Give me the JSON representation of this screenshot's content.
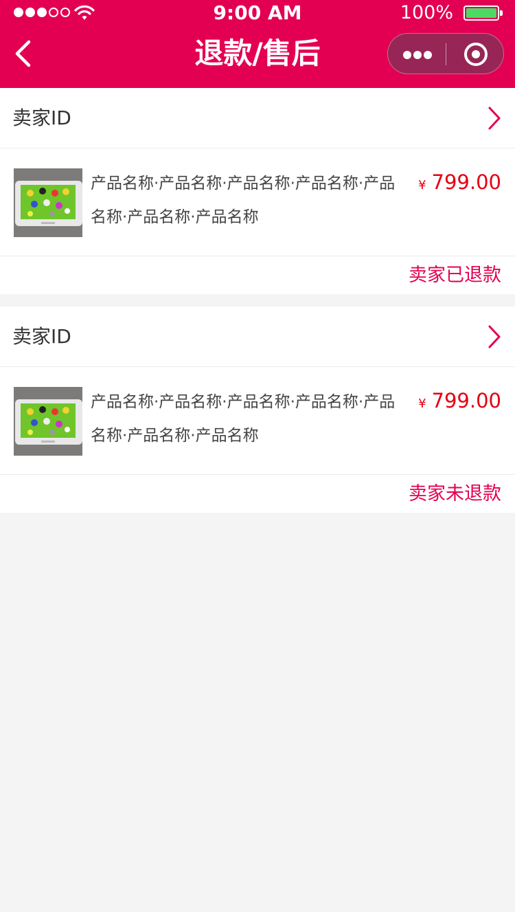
{
  "status_bar": {
    "time": "9:00 AM",
    "battery": "100%"
  },
  "nav": {
    "title": "退款/售后"
  },
  "colors": {
    "brand": "#e30052",
    "price": "#e50012",
    "background": "#f4f4f4"
  },
  "orders": [
    {
      "seller": "卖家ID",
      "product_name": "产品名称·产品名称·产品名称·产品名称·产品名称·产品名称·产品名称",
      "currency": "¥",
      "price": "799.00",
      "status": "卖家已退款"
    },
    {
      "seller": "卖家ID",
      "product_name": "产品名称·产品名称·产品名称·产品名称·产品名称·产品名称·产品名称",
      "currency": "¥",
      "price": "799.00",
      "status": "卖家未退款"
    }
  ]
}
